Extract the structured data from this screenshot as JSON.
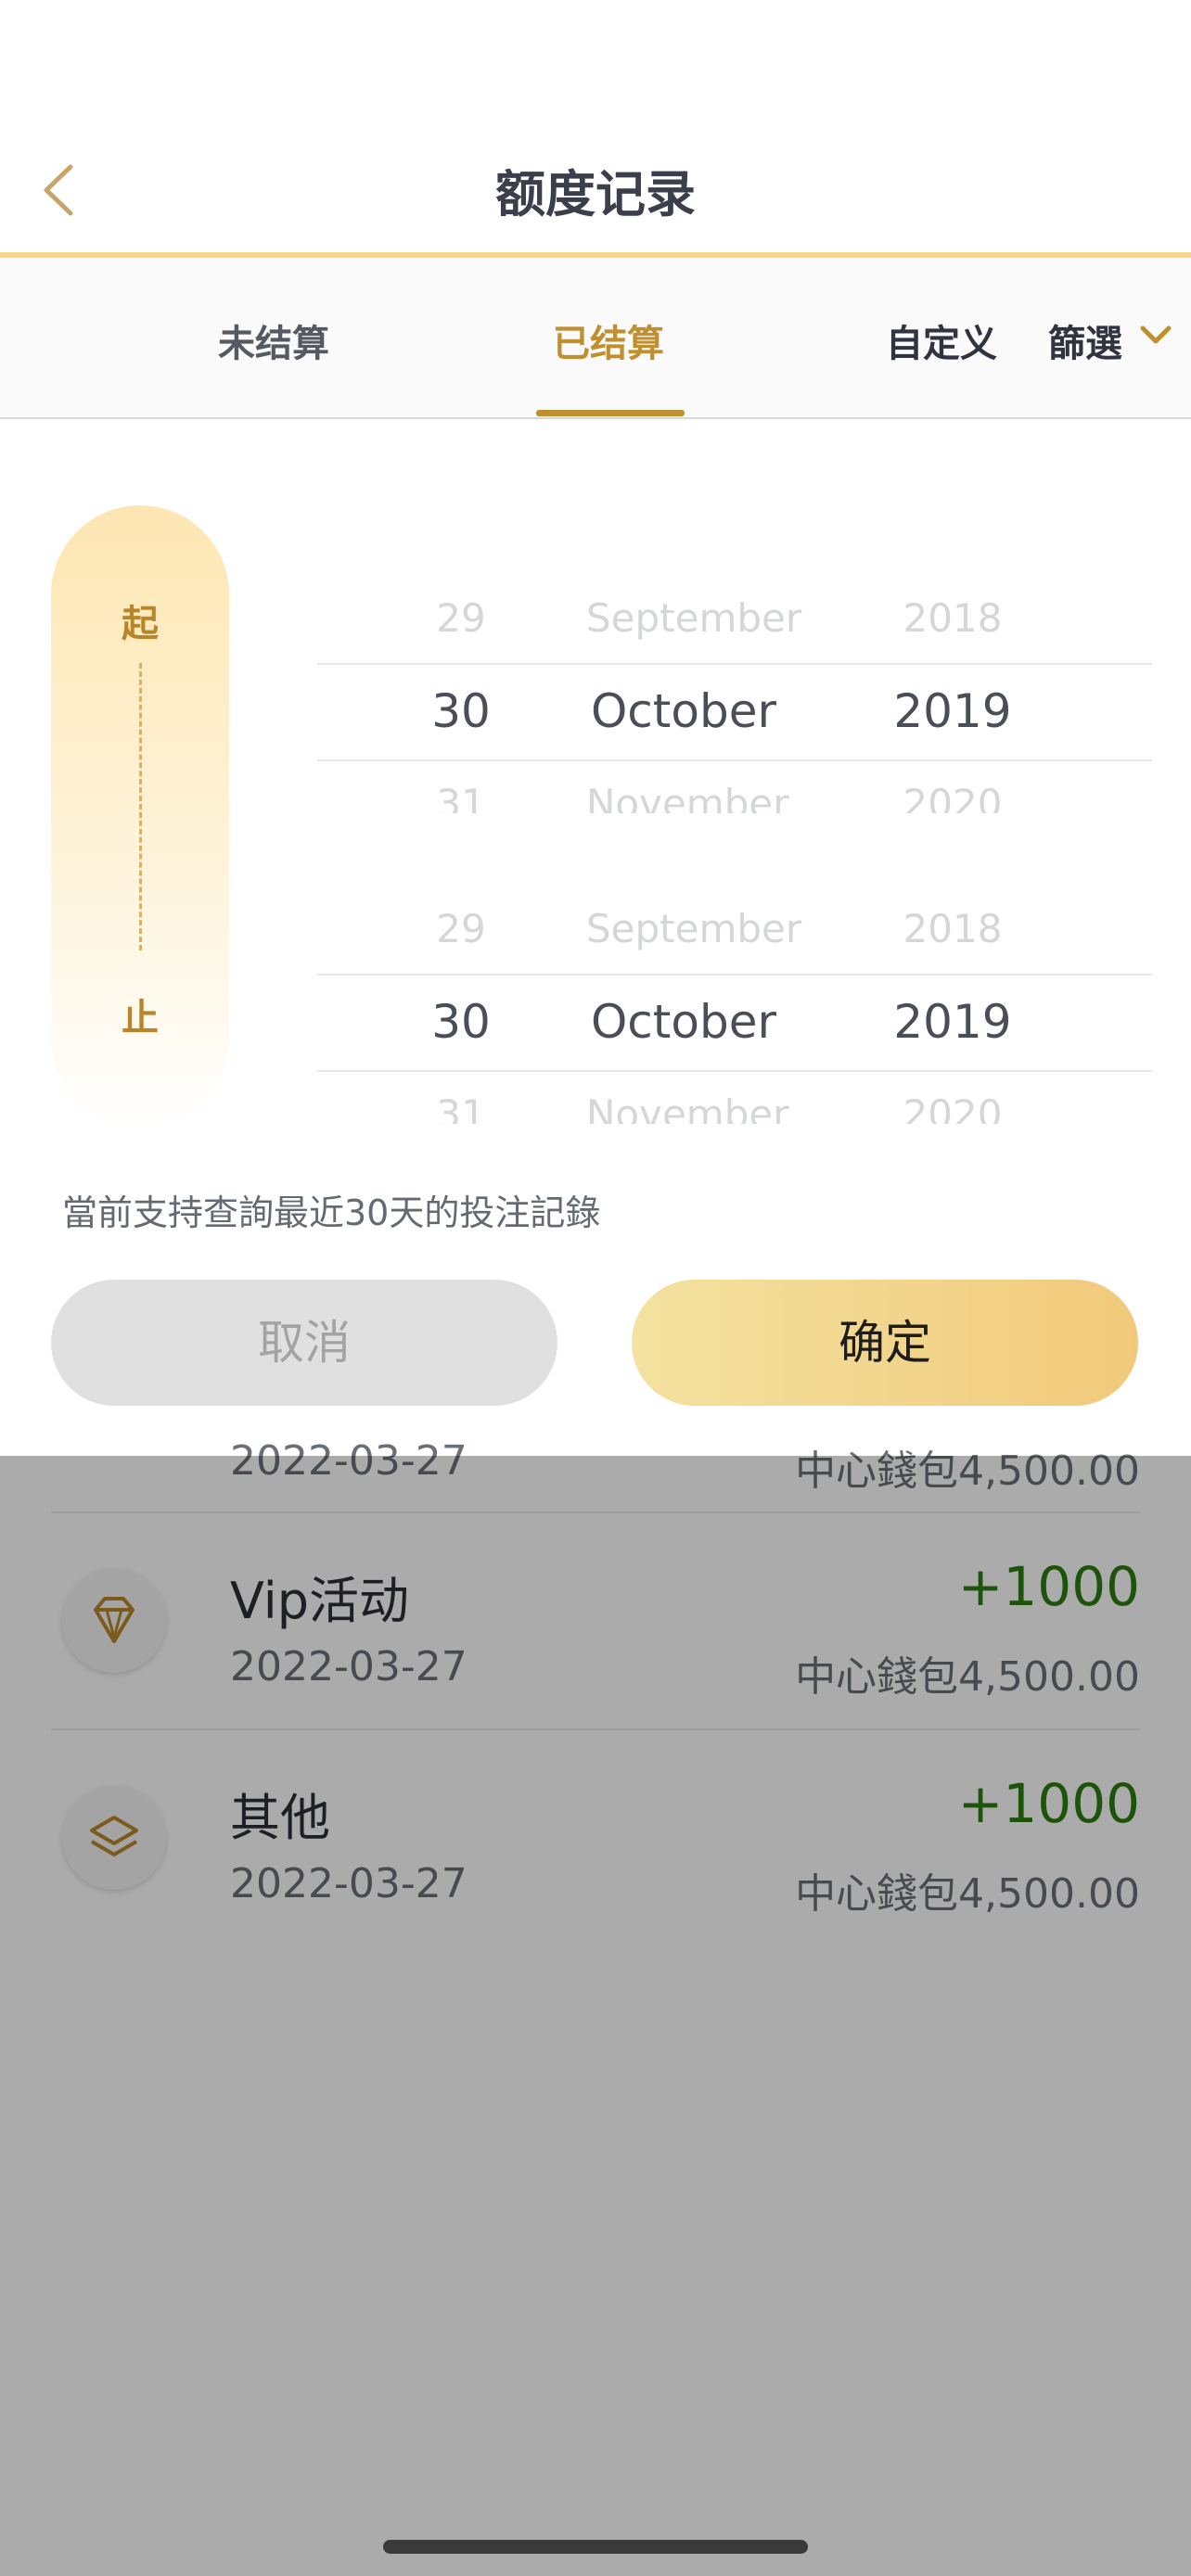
{
  "header": {
    "title": "额度记录"
  },
  "tabs": {
    "unsettled": "未结算",
    "settled": "已结算",
    "custom": "自定义",
    "filter": "篩選"
  },
  "range": {
    "start": "起",
    "end": "止"
  },
  "picker_start": {
    "prev": {
      "day": "29",
      "month": "September",
      "year": "2018"
    },
    "selected": {
      "day": "30",
      "month": "October",
      "year": "2019"
    },
    "next": {
      "day": "31",
      "month": "November",
      "year": "2020"
    }
  },
  "picker_end": {
    "prev": {
      "day": "29",
      "month": "September",
      "year": "2018"
    },
    "selected": {
      "day": "30",
      "month": "October",
      "year": "2019"
    },
    "next": {
      "day": "31",
      "month": "November",
      "year": "2020"
    }
  },
  "note": "當前支持查詢最近30天的投注記錄",
  "buttons": {
    "cancel": "取消",
    "confirm": "确定"
  },
  "list": {
    "partial": {
      "date": "2022-03-27",
      "wallet": "中心錢包4,500.00"
    },
    "items": [
      {
        "icon": "diamond-icon",
        "title": "Vip活动",
        "date": "2022-03-27",
        "amount": "+1000",
        "wallet": "中心錢包4,500.00"
      },
      {
        "icon": "layers-icon",
        "title": "其他",
        "date": "2022-03-27",
        "amount": "+1000",
        "wallet": "中心錢包4,500.00"
      }
    ]
  },
  "colors": {
    "accent_gold": "#c0902e",
    "positive_green": "#2e7d12",
    "confirm_gradient_start": "#f3e2a0",
    "confirm_gradient_end": "#f2c97a"
  }
}
